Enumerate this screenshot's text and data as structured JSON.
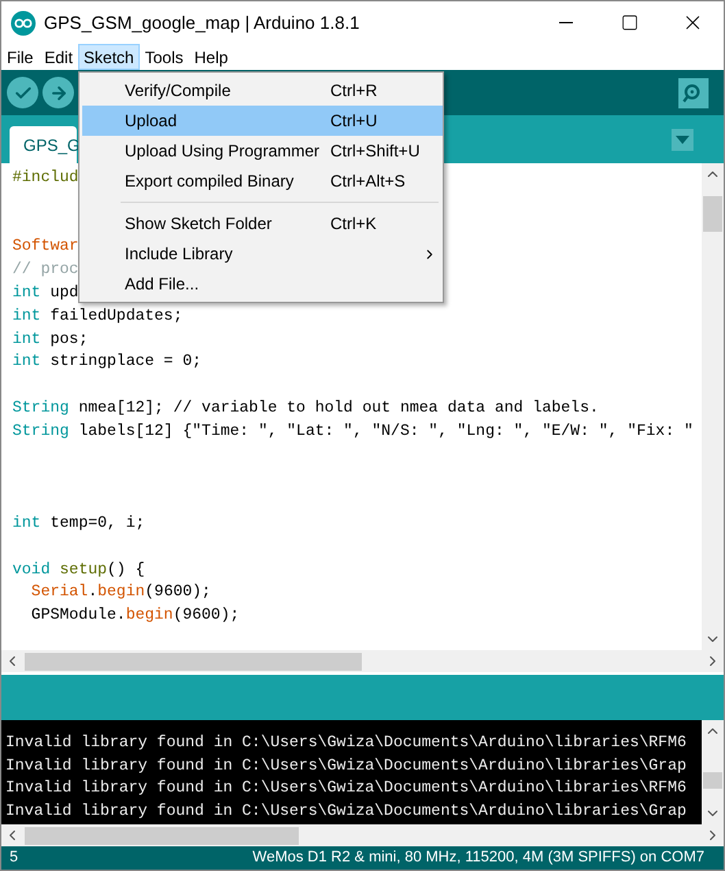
{
  "window": {
    "title": "GPS_GSM_google_map | Arduino 1.8.1"
  },
  "menubar": [
    {
      "label": "File",
      "selected": false
    },
    {
      "label": "Edit",
      "selected": false
    },
    {
      "label": "Sketch",
      "selected": true
    },
    {
      "label": "Tools",
      "selected": false
    },
    {
      "label": "Help",
      "selected": false
    }
  ],
  "sketch_menu": [
    {
      "kind": "item",
      "label": "Verify/Compile",
      "shortcut": "Ctrl+R",
      "selected": false
    },
    {
      "kind": "item",
      "label": "Upload",
      "shortcut": "Ctrl+U",
      "selected": true
    },
    {
      "kind": "item",
      "label": "Upload Using Programmer",
      "shortcut": "Ctrl+Shift+U",
      "selected": false
    },
    {
      "kind": "item",
      "label": "Export compiled Binary",
      "shortcut": "Ctrl+Alt+S",
      "selected": false
    },
    {
      "kind": "separator"
    },
    {
      "kind": "item",
      "label": "Show Sketch Folder",
      "shortcut": "Ctrl+K",
      "selected": false
    },
    {
      "kind": "submenu",
      "label": "Include Library",
      "selected": false
    },
    {
      "kind": "item",
      "label": "Add File...",
      "selected": false
    }
  ],
  "tabs": [
    {
      "label": "GPS_G",
      "selected": true
    }
  ],
  "editor": {
    "lines": [
      {
        "kind": "code",
        "parts": [
          {
            "kind": "preproc",
            "text": "#includ"
          }
        ]
      },
      {
        "kind": "blank"
      },
      {
        "kind": "blank"
      },
      {
        "kind": "code",
        "parts": [
          {
            "kind": "class",
            "text": "Softwar"
          }
        ]
      },
      {
        "kind": "code",
        "parts": [
          {
            "kind": "comment",
            "text": "// proc"
          }
        ]
      },
      {
        "kind": "code",
        "parts": [
          {
            "kind": "type",
            "text": "int"
          },
          {
            "kind": "plain",
            "text": " upd"
          }
        ]
      },
      {
        "kind": "code",
        "parts": [
          {
            "kind": "type",
            "text": "int"
          },
          {
            "kind": "plain",
            "text": " failedUpdates;"
          }
        ]
      },
      {
        "kind": "code",
        "parts": [
          {
            "kind": "type",
            "text": "int"
          },
          {
            "kind": "plain",
            "text": " pos;"
          }
        ]
      },
      {
        "kind": "code",
        "parts": [
          {
            "kind": "type",
            "text": "int"
          },
          {
            "kind": "plain",
            "text": " stringplace = 0;"
          }
        ]
      },
      {
        "kind": "blank"
      },
      {
        "kind": "code",
        "parts": [
          {
            "kind": "type",
            "text": "String"
          },
          {
            "kind": "plain",
            "text": " nmea[12]; // variable to hold out nmea data and labels."
          }
        ]
      },
      {
        "kind": "code",
        "parts": [
          {
            "kind": "type",
            "text": "String"
          },
          {
            "kind": "plain",
            "text": " labels[12] {\"Time: \", \"Lat: \", \"N/S: \", \"Lng: \", \"E/W: \", \"Fix: \""
          }
        ]
      },
      {
        "kind": "blank"
      },
      {
        "kind": "blank"
      },
      {
        "kind": "blank"
      },
      {
        "kind": "code",
        "parts": [
          {
            "kind": "type",
            "text": "int"
          },
          {
            "kind": "plain",
            "text": " temp=0, i;"
          }
        ]
      },
      {
        "kind": "blank"
      },
      {
        "kind": "code",
        "parts": [
          {
            "kind": "type",
            "text": "void "
          },
          {
            "kind": "func",
            "text": "setup"
          },
          {
            "kind": "plain",
            "text": "() {"
          }
        ]
      },
      {
        "kind": "code",
        "indented": true,
        "parts": [
          {
            "kind": "class",
            "text": "Serial"
          },
          {
            "kind": "plain",
            "text": "."
          },
          {
            "kind": "class",
            "text": "begin"
          },
          {
            "kind": "plain",
            "text": "(9600);"
          }
        ]
      },
      {
        "kind": "code",
        "indented": true,
        "parts": [
          {
            "kind": "plain",
            "text": "GPSModule."
          },
          {
            "kind": "class",
            "text": "begin"
          },
          {
            "kind": "plain",
            "text": "(9600);"
          }
        ]
      }
    ]
  },
  "console": {
    "lines": [
      "Invalid library found in C:\\Users\\Gwiza\\Documents\\Arduino\\libraries\\RFM6",
      "Invalid library found in C:\\Users\\Gwiza\\Documents\\Arduino\\libraries\\Grap",
      "Invalid library found in C:\\Users\\Gwiza\\Documents\\Arduino\\libraries\\RFM6",
      "Invalid library found in C:\\Users\\Gwiza\\Documents\\Arduino\\libraries\\Grap"
    ]
  },
  "status_bar": {
    "line": "5",
    "board": "WeMos D1 R2 & mini, 80 MHz, 115200, 4M (3M SPIFFS) on COM7"
  }
}
